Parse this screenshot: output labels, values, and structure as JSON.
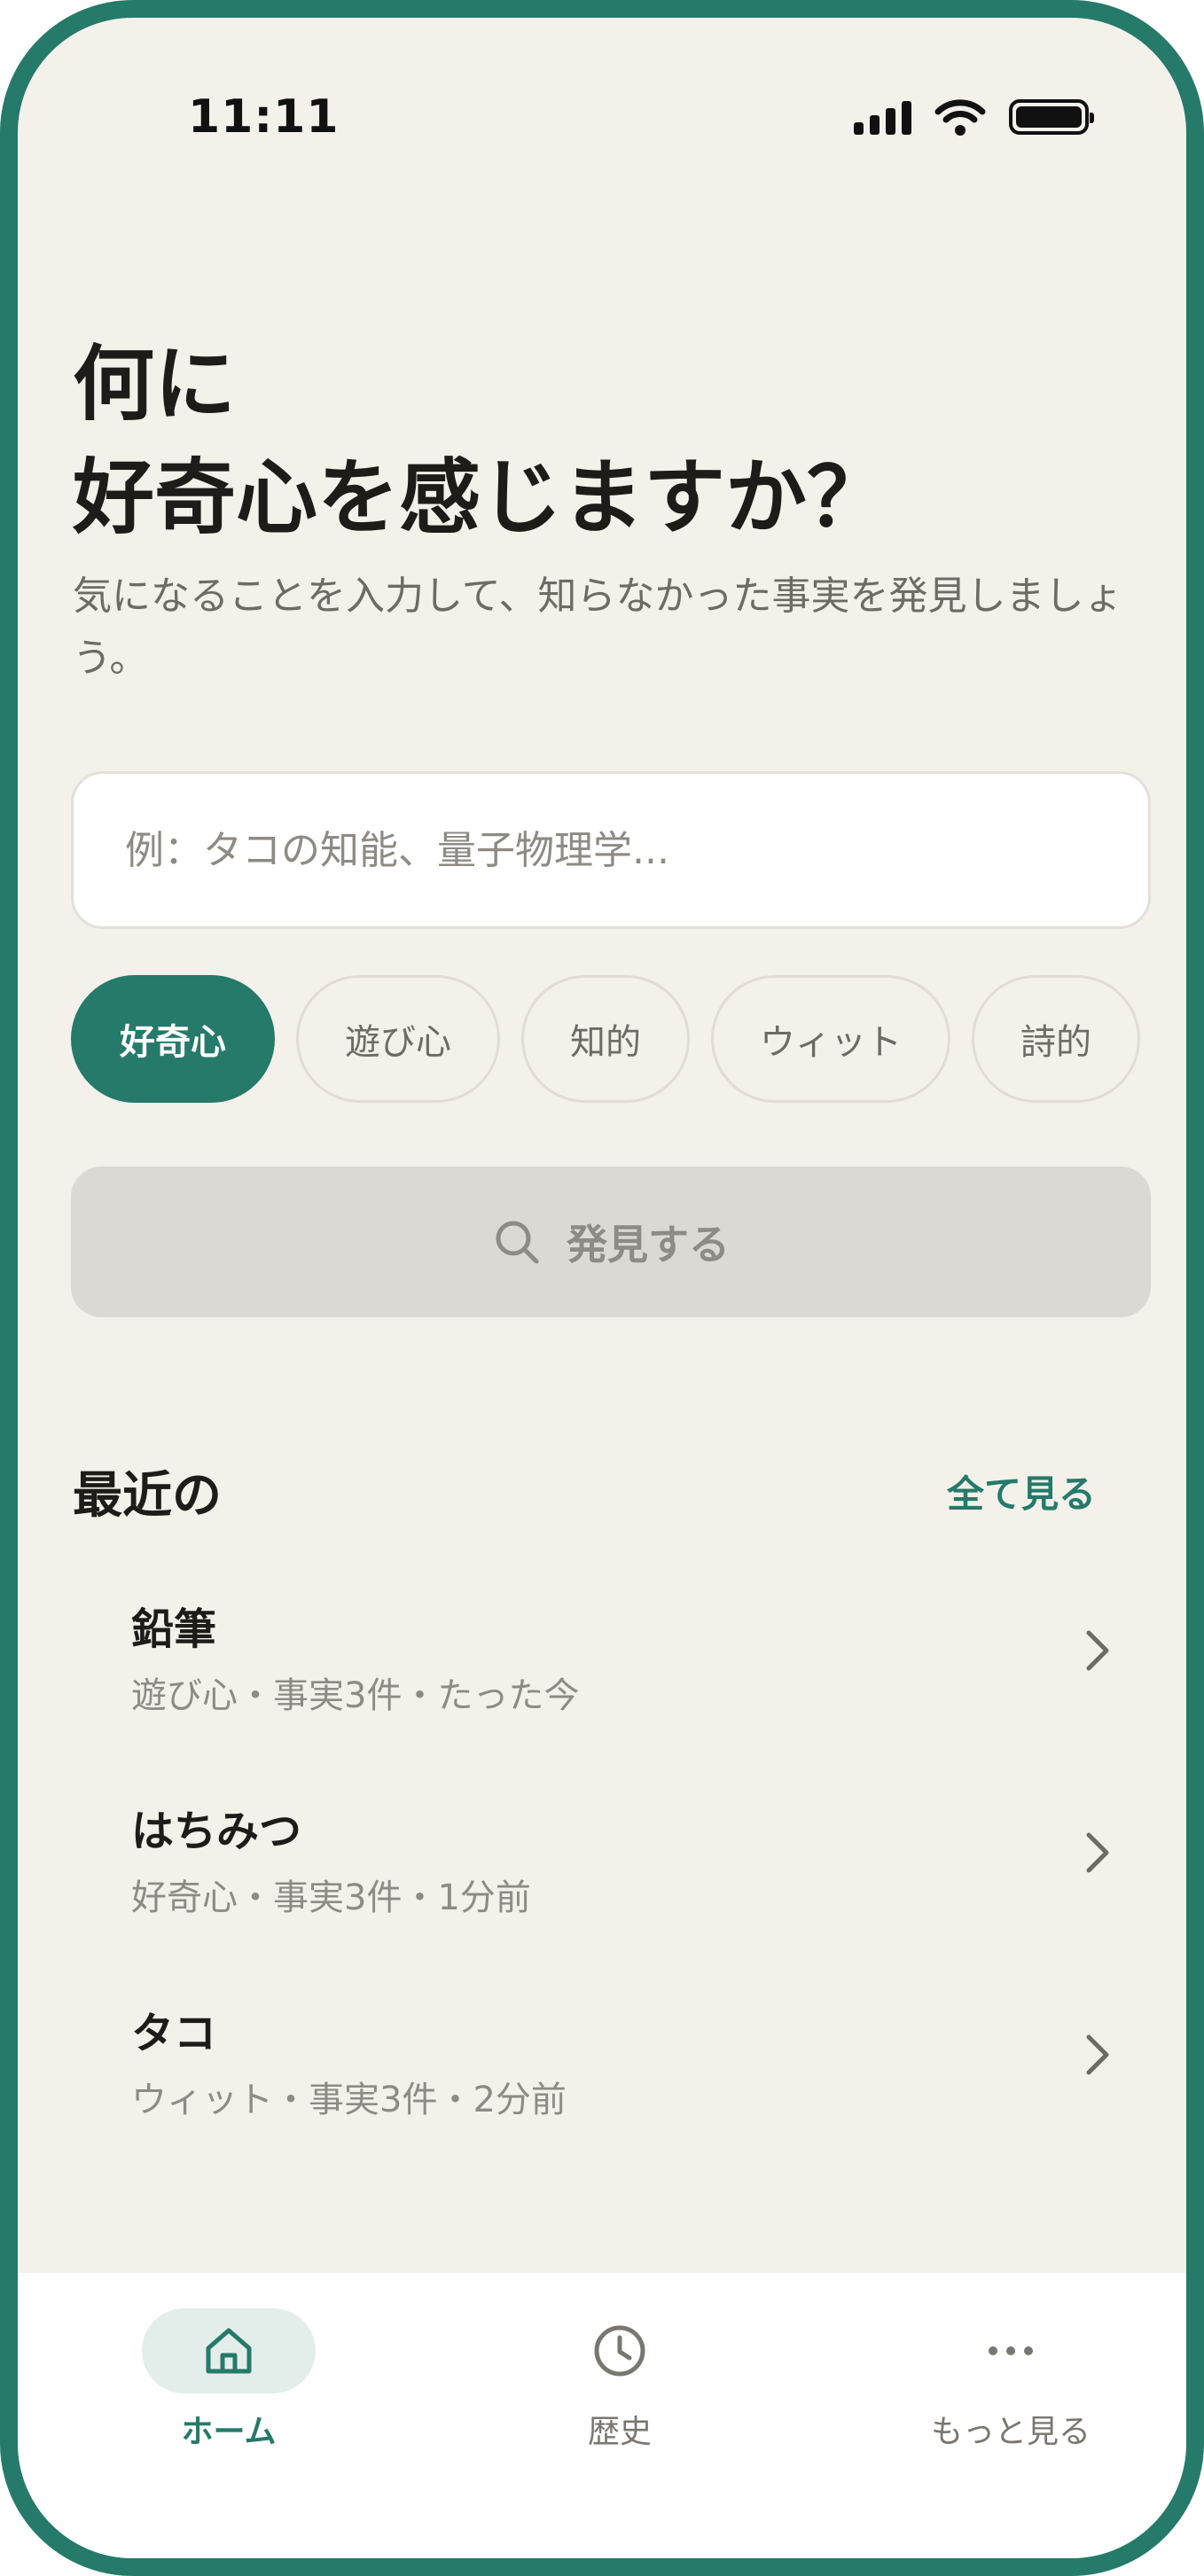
{
  "status_bar": {
    "time": "11:11"
  },
  "hero": {
    "title_line1": "何に",
    "title_line2": "好奇心を感じますか？",
    "subtitle": "気になることを入力して、知らなかった事実を発見しましょう。"
  },
  "search": {
    "value": "",
    "placeholder": "例：タコの知能、量子物理学..."
  },
  "tones": [
    {
      "label": "好奇心",
      "selected": true
    },
    {
      "label": "遊び心",
      "selected": false
    },
    {
      "label": "知的",
      "selected": false
    },
    {
      "label": "ウィット",
      "selected": false
    },
    {
      "label": "詩的",
      "selected": false
    }
  ],
  "discover_button": {
    "label": "発見する",
    "icon": "search-icon",
    "enabled": false
  },
  "recent": {
    "title": "最近の",
    "see_all_label": "全て見る",
    "items": [
      {
        "title": "鉛筆",
        "meta": "遊び心・事実3件・たった今"
      },
      {
        "title": "はちみつ",
        "meta": "好奇心・事実3件・1分前"
      },
      {
        "title": "タコ",
        "meta": "ウィット・事実3件・2分前"
      }
    ]
  },
  "bottom_nav": {
    "items": [
      {
        "label": "ホーム",
        "icon": "home-icon",
        "active": true
      },
      {
        "label": "歴史",
        "icon": "clock-icon",
        "active": false
      },
      {
        "label": "もっと見る",
        "icon": "more-dots-icon",
        "active": false
      }
    ]
  },
  "colors": {
    "accent": "#257A6A",
    "background": "#F4F1EB",
    "disabled_button": "#DCD9D4",
    "nav_active_bg": "#E3EEEA"
  }
}
